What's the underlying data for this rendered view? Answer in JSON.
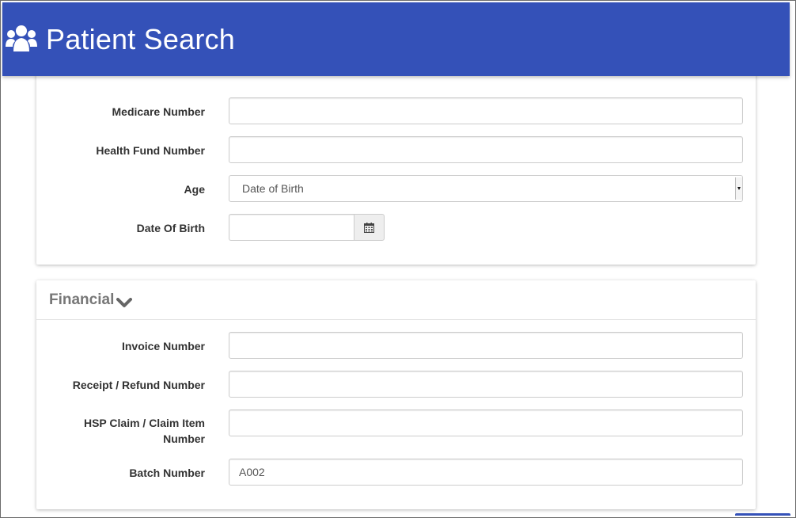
{
  "header": {
    "title": "Patient Search",
    "icon": "users-icon",
    "background_color": "#3451b8"
  },
  "identification_section": {
    "fields": {
      "medicare_number": {
        "label": "Medicare Number",
        "value": ""
      },
      "health_fund_number": {
        "label": "Health Fund Number",
        "value": ""
      },
      "age": {
        "label": "Age",
        "selected": "Date of Birth"
      },
      "date_of_birth": {
        "label": "Date Of Birth",
        "value": "",
        "icon": "calendar-icon"
      }
    }
  },
  "financial_section": {
    "title": "Financial",
    "toggle_icon": "chevron-down-icon",
    "fields": {
      "invoice_number": {
        "label": "Invoice Number",
        "value": ""
      },
      "receipt_refund_number": {
        "label": "Receipt / Refund Number",
        "value": ""
      },
      "hsp_claim_line1": "HSP Claim / Claim Item",
      "hsp_claim_line2": "Number",
      "hsp_claim_value": "",
      "batch_number": {
        "label": "Batch Number",
        "value": "A002"
      }
    }
  }
}
